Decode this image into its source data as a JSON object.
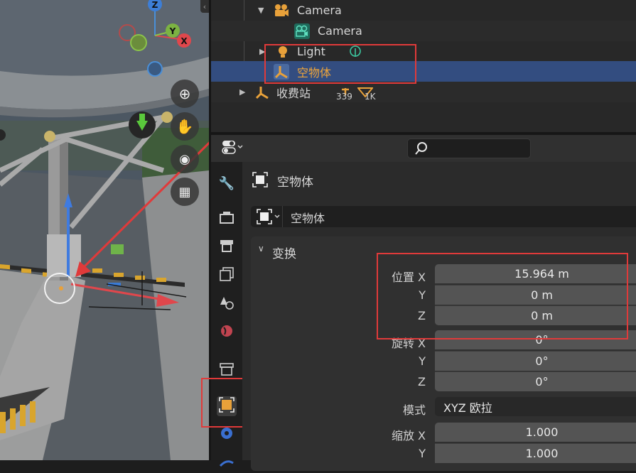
{
  "outliner": {
    "rows": [
      {
        "label": "Camera",
        "icon": "camera-collection-icon"
      },
      {
        "label": "Camera",
        "icon": "camera-data-icon"
      },
      {
        "label": "Light",
        "icon": "light-icon"
      },
      {
        "label": "空物体",
        "icon": "empty-axes-icon"
      },
      {
        "label": "收费站",
        "icon": "empty-axes-icon",
        "vertex_count": "339",
        "face_count": "1K"
      }
    ]
  },
  "properties": {
    "header_title": "空物体",
    "object_name": "空物体",
    "transform_section": "变换",
    "location_label": "位置 X",
    "rotation_label": "旋转 X",
    "mode_label": "模式",
    "scale_label": "缩放 X",
    "axis_y": "Y",
    "axis_z": "Z",
    "location": [
      "15.964 m",
      "0 m",
      "0 m"
    ],
    "rotation": [
      "0°",
      "0°",
      "0°"
    ],
    "rotation_mode": "XYZ 欧拉",
    "scale": [
      "1.000",
      "1.000"
    ]
  },
  "gizmo": {
    "z": "Z",
    "y": "Y",
    "x": "X"
  },
  "colors": {
    "highlight": "#e03a3a",
    "selection": "#334d80",
    "object_orange": "#e8a13a",
    "field": "#545454"
  }
}
